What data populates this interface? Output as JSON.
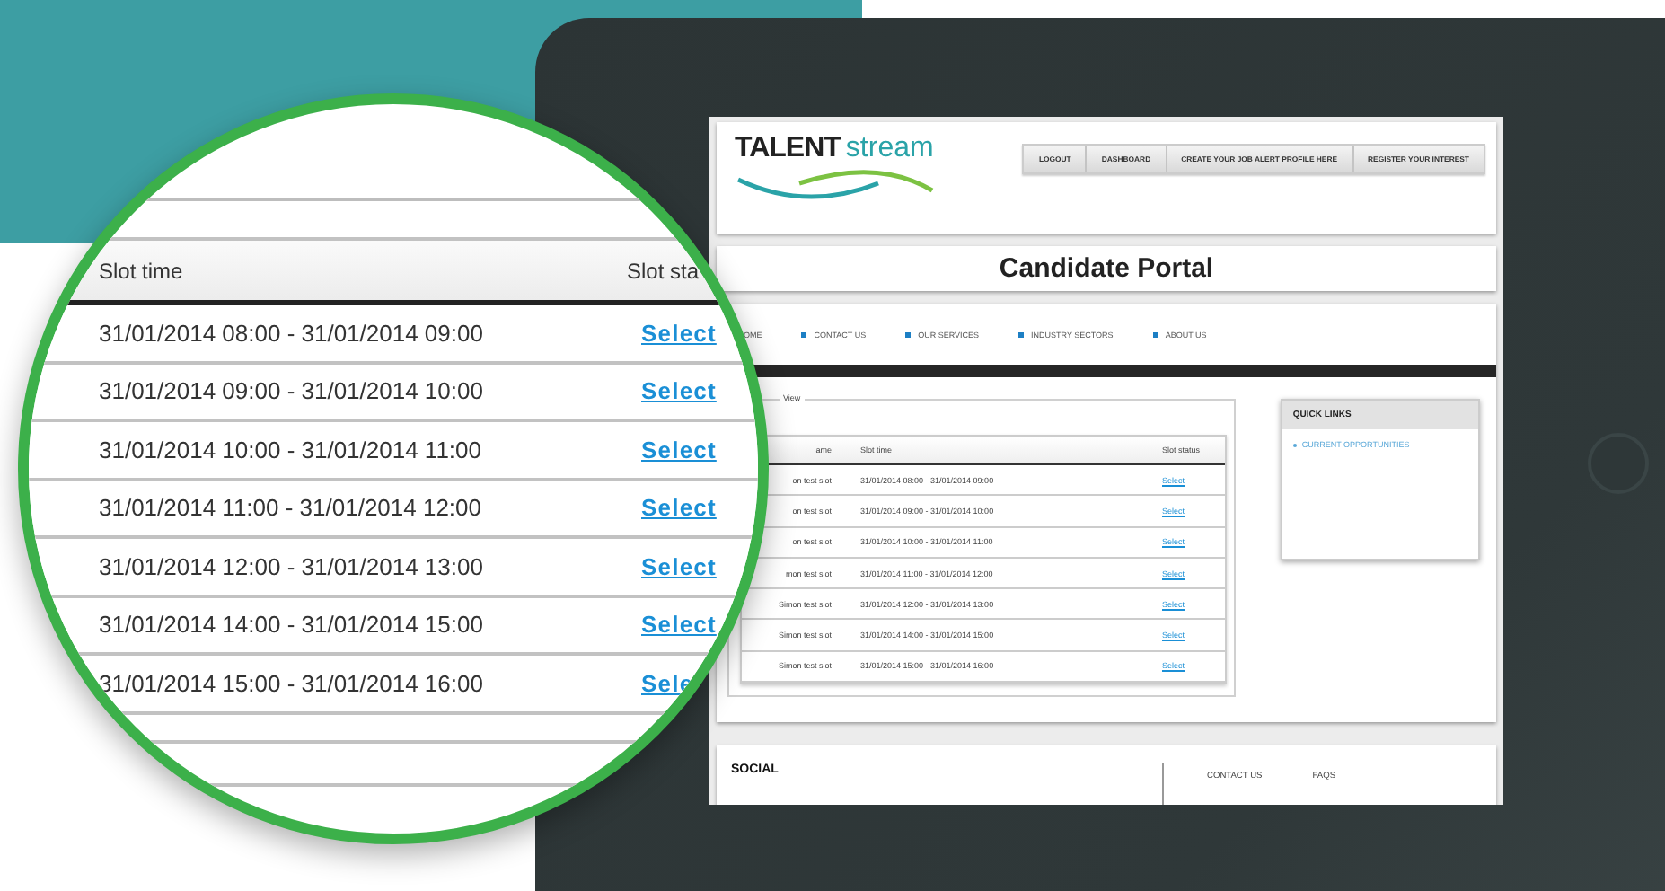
{
  "magnifier": {
    "columns": [
      "Slot time",
      "Slot sta"
    ],
    "rows": [
      {
        "time": "31/01/2014 08:00 - 31/01/2014 09:00",
        "status": "Select"
      },
      {
        "time": "31/01/2014 09:00 - 31/01/2014 10:00",
        "status": "Select"
      },
      {
        "time": "31/01/2014 10:00 - 31/01/2014 11:00",
        "status": "Select"
      },
      {
        "time": "31/01/2014 11:00 - 31/01/2014 12:00",
        "status": "Select"
      },
      {
        "time": "31/01/2014 12:00 - 31/01/2014 13:00",
        "status": "Select"
      },
      {
        "time": "31/01/2014 14:00 - 31/01/2014 15:00",
        "status": "Select"
      },
      {
        "time": "31/01/2014 15:00 - 31/01/2014 16:00",
        "status": "Sele"
      }
    ]
  },
  "logo": {
    "word_1": "TALENT",
    "word_2": "stream"
  },
  "top_menu": [
    "LOGOUT",
    "DASHBOARD",
    "CREATE YOUR JOB ALERT PROFILE HERE",
    "REGISTER YOUR INTEREST"
  ],
  "page_title": "Candidate Portal",
  "nav": [
    "OME",
    "CONTACT US",
    "OUR SERVICES",
    "INDUSTRY SECTORS",
    "ABOUT US"
  ],
  "slots_panel": {
    "legend": "View",
    "columns": [
      "ame",
      "Slot time",
      "Slot status"
    ],
    "rows": [
      {
        "name": "on test slot",
        "time": "31/01/2014 08:00 - 31/01/2014 09:00",
        "status": "Select"
      },
      {
        "name": "on test slot",
        "time": "31/01/2014 09:00 - 31/01/2014 10:00",
        "status": "Select"
      },
      {
        "name": "on test slot",
        "time": "31/01/2014 10:00 - 31/01/2014 11:00",
        "status": "Select"
      },
      {
        "name": "mon test slot",
        "time": "31/01/2014 11:00 - 31/01/2014 12:00",
        "status": "Select"
      },
      {
        "name": "Simon test slot",
        "time": "31/01/2014 12:00 - 31/01/2014 13:00",
        "status": "Select"
      },
      {
        "name": "Simon test slot",
        "time": "31/01/2014 14:00 - 31/01/2014 15:00",
        "status": "Select"
      },
      {
        "name": "Simon test slot",
        "time": "31/01/2014 15:00 - 31/01/2014 16:00",
        "status": "Select"
      }
    ]
  },
  "quick_links": {
    "title": "QUICK LINKS",
    "items": [
      "CURRENT OPPORTUNITIES"
    ]
  },
  "footer": {
    "social_title": "SOCIAL",
    "links": [
      "CONTACT US",
      "FAQS"
    ]
  }
}
